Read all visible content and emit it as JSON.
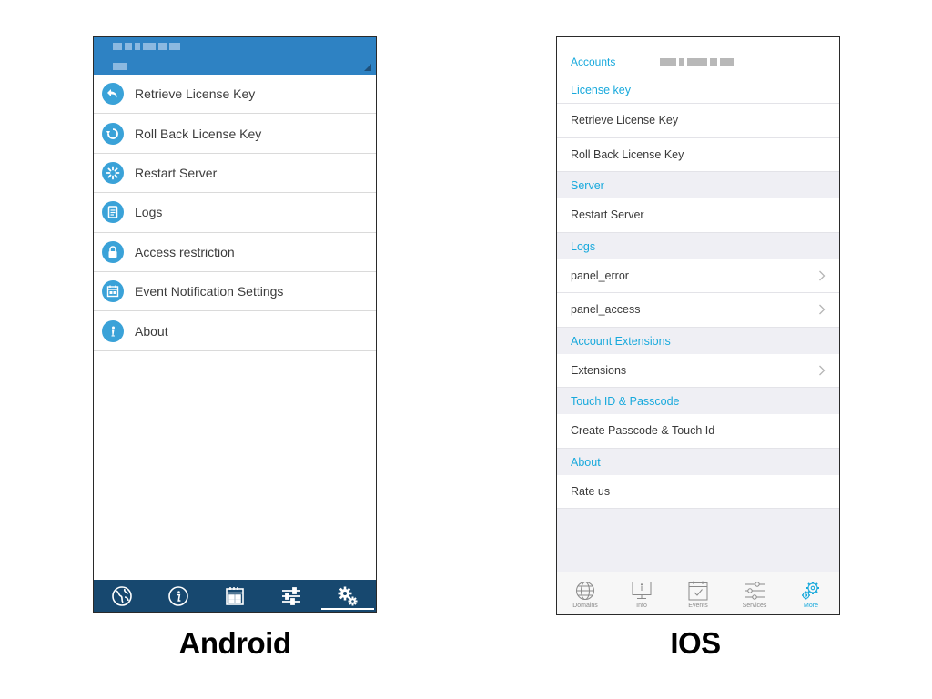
{
  "android": {
    "caption": "Android",
    "menu": [
      {
        "label": "Retrieve License Key",
        "icon": "undo-arrow-icon"
      },
      {
        "label": "Roll Back License Key",
        "icon": "rollback-icon"
      },
      {
        "label": "Restart Server",
        "icon": "restart-spinner-icon"
      },
      {
        "label": "Logs",
        "icon": "document-icon"
      },
      {
        "label": "Access restriction",
        "icon": "lock-icon"
      },
      {
        "label": "Event Notification Settings",
        "icon": "calendar-icon"
      },
      {
        "label": "About",
        "icon": "info-icon"
      }
    ],
    "tabs": [
      "globe-icon",
      "info-icon",
      "calendar-icon",
      "sliders-icon",
      "gears-icon"
    ],
    "active_tab": 4,
    "colors": {
      "header": "#2e82c3",
      "tabbar": "#17486f",
      "icon": "#3aa2d8"
    }
  },
  "ios": {
    "caption": "IOS",
    "account_label": "Accounts",
    "sections": [
      {
        "title": "License key",
        "rows": [
          {
            "label": "Retrieve License Key",
            "chevron": false
          },
          {
            "label": "Roll Back License Key",
            "chevron": false
          }
        ]
      },
      {
        "title": "Server",
        "rows": [
          {
            "label": "Restart Server",
            "chevron": false
          }
        ]
      },
      {
        "title": "Logs",
        "rows": [
          {
            "label": "panel_error",
            "chevron": true
          },
          {
            "label": "panel_access",
            "chevron": true
          }
        ]
      },
      {
        "title": "Account Extensions",
        "rows": [
          {
            "label": "Extensions",
            "chevron": true
          }
        ]
      },
      {
        "title": "Touch ID & Passcode",
        "rows": [
          {
            "label": "Create Passcode & Touch Id",
            "chevron": false
          }
        ]
      },
      {
        "title": "About",
        "rows": [
          {
            "label": "Rate us",
            "chevron": false
          }
        ]
      }
    ],
    "tabs": [
      {
        "label": "Domains",
        "icon": "globe-icon"
      },
      {
        "label": "Info",
        "icon": "monitor-icon"
      },
      {
        "label": "Events",
        "icon": "calendar-check-icon"
      },
      {
        "label": "Services",
        "icon": "sliders-icon"
      },
      {
        "label": "More",
        "icon": "gears-icon"
      }
    ],
    "active_tab": 4,
    "colors": {
      "accent": "#18a9dc",
      "background": "#efeff4"
    }
  }
}
